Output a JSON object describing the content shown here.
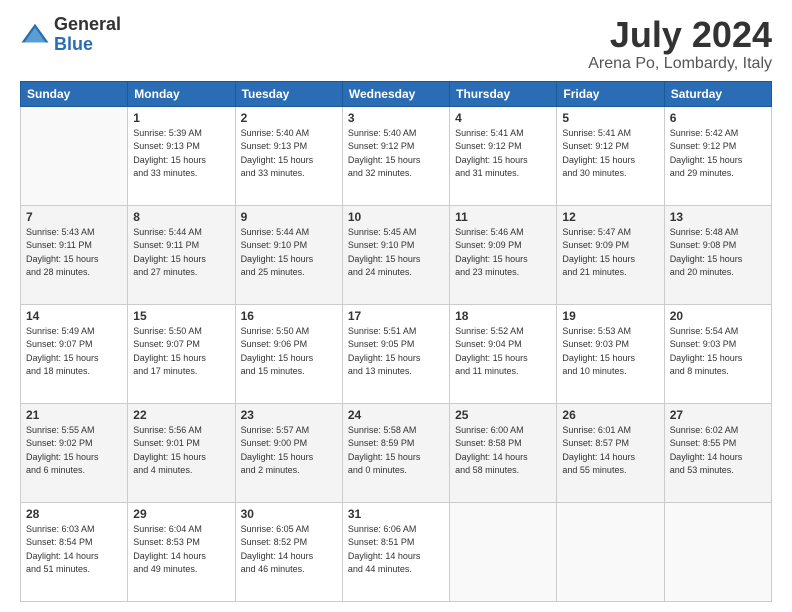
{
  "header": {
    "logo": {
      "line1": "General",
      "line2": "Blue"
    },
    "title": "July 2024",
    "location": "Arena Po, Lombardy, Italy"
  },
  "days_of_week": [
    "Sunday",
    "Monday",
    "Tuesday",
    "Wednesday",
    "Thursday",
    "Friday",
    "Saturday"
  ],
  "weeks": [
    [
      {
        "day": "",
        "info": ""
      },
      {
        "day": "1",
        "info": "Sunrise: 5:39 AM\nSunset: 9:13 PM\nDaylight: 15 hours\nand 33 minutes."
      },
      {
        "day": "2",
        "info": "Sunrise: 5:40 AM\nSunset: 9:13 PM\nDaylight: 15 hours\nand 33 minutes."
      },
      {
        "day": "3",
        "info": "Sunrise: 5:40 AM\nSunset: 9:12 PM\nDaylight: 15 hours\nand 32 minutes."
      },
      {
        "day": "4",
        "info": "Sunrise: 5:41 AM\nSunset: 9:12 PM\nDaylight: 15 hours\nand 31 minutes."
      },
      {
        "day": "5",
        "info": "Sunrise: 5:41 AM\nSunset: 9:12 PM\nDaylight: 15 hours\nand 30 minutes."
      },
      {
        "day": "6",
        "info": "Sunrise: 5:42 AM\nSunset: 9:12 PM\nDaylight: 15 hours\nand 29 minutes."
      }
    ],
    [
      {
        "day": "7",
        "info": "Sunrise: 5:43 AM\nSunset: 9:11 PM\nDaylight: 15 hours\nand 28 minutes."
      },
      {
        "day": "8",
        "info": "Sunrise: 5:44 AM\nSunset: 9:11 PM\nDaylight: 15 hours\nand 27 minutes."
      },
      {
        "day": "9",
        "info": "Sunrise: 5:44 AM\nSunset: 9:10 PM\nDaylight: 15 hours\nand 25 minutes."
      },
      {
        "day": "10",
        "info": "Sunrise: 5:45 AM\nSunset: 9:10 PM\nDaylight: 15 hours\nand 24 minutes."
      },
      {
        "day": "11",
        "info": "Sunrise: 5:46 AM\nSunset: 9:09 PM\nDaylight: 15 hours\nand 23 minutes."
      },
      {
        "day": "12",
        "info": "Sunrise: 5:47 AM\nSunset: 9:09 PM\nDaylight: 15 hours\nand 21 minutes."
      },
      {
        "day": "13",
        "info": "Sunrise: 5:48 AM\nSunset: 9:08 PM\nDaylight: 15 hours\nand 20 minutes."
      }
    ],
    [
      {
        "day": "14",
        "info": "Sunrise: 5:49 AM\nSunset: 9:07 PM\nDaylight: 15 hours\nand 18 minutes."
      },
      {
        "day": "15",
        "info": "Sunrise: 5:50 AM\nSunset: 9:07 PM\nDaylight: 15 hours\nand 17 minutes."
      },
      {
        "day": "16",
        "info": "Sunrise: 5:50 AM\nSunset: 9:06 PM\nDaylight: 15 hours\nand 15 minutes."
      },
      {
        "day": "17",
        "info": "Sunrise: 5:51 AM\nSunset: 9:05 PM\nDaylight: 15 hours\nand 13 minutes."
      },
      {
        "day": "18",
        "info": "Sunrise: 5:52 AM\nSunset: 9:04 PM\nDaylight: 15 hours\nand 11 minutes."
      },
      {
        "day": "19",
        "info": "Sunrise: 5:53 AM\nSunset: 9:03 PM\nDaylight: 15 hours\nand 10 minutes."
      },
      {
        "day": "20",
        "info": "Sunrise: 5:54 AM\nSunset: 9:03 PM\nDaylight: 15 hours\nand 8 minutes."
      }
    ],
    [
      {
        "day": "21",
        "info": "Sunrise: 5:55 AM\nSunset: 9:02 PM\nDaylight: 15 hours\nand 6 minutes."
      },
      {
        "day": "22",
        "info": "Sunrise: 5:56 AM\nSunset: 9:01 PM\nDaylight: 15 hours\nand 4 minutes."
      },
      {
        "day": "23",
        "info": "Sunrise: 5:57 AM\nSunset: 9:00 PM\nDaylight: 15 hours\nand 2 minutes."
      },
      {
        "day": "24",
        "info": "Sunrise: 5:58 AM\nSunset: 8:59 PM\nDaylight: 15 hours\nand 0 minutes."
      },
      {
        "day": "25",
        "info": "Sunrise: 6:00 AM\nSunset: 8:58 PM\nDaylight: 14 hours\nand 58 minutes."
      },
      {
        "day": "26",
        "info": "Sunrise: 6:01 AM\nSunset: 8:57 PM\nDaylight: 14 hours\nand 55 minutes."
      },
      {
        "day": "27",
        "info": "Sunrise: 6:02 AM\nSunset: 8:55 PM\nDaylight: 14 hours\nand 53 minutes."
      }
    ],
    [
      {
        "day": "28",
        "info": "Sunrise: 6:03 AM\nSunset: 8:54 PM\nDaylight: 14 hours\nand 51 minutes."
      },
      {
        "day": "29",
        "info": "Sunrise: 6:04 AM\nSunset: 8:53 PM\nDaylight: 14 hours\nand 49 minutes."
      },
      {
        "day": "30",
        "info": "Sunrise: 6:05 AM\nSunset: 8:52 PM\nDaylight: 14 hours\nand 46 minutes."
      },
      {
        "day": "31",
        "info": "Sunrise: 6:06 AM\nSunset: 8:51 PM\nDaylight: 14 hours\nand 44 minutes."
      },
      {
        "day": "",
        "info": ""
      },
      {
        "day": "",
        "info": ""
      },
      {
        "day": "",
        "info": ""
      }
    ]
  ]
}
